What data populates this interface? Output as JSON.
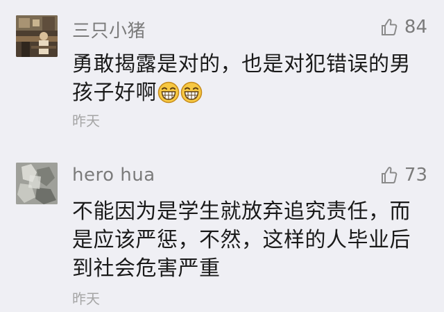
{
  "comments": [
    {
      "username": "三只小猪",
      "likes": "84",
      "body_before_emoji": "勇敢揭露是对的，也是对犯错误的男孩子好啊",
      "emojis": [
        "grinning-face-icon",
        "grinning-face-icon"
      ],
      "time": "昨天"
    },
    {
      "username": "hero hua",
      "likes": "73",
      "body": "不能因为是学生就放弃追究责任，而是应该严惩，不然，这样的人毕业后到社会危害严重",
      "time": "昨天"
    }
  ],
  "icons": {
    "like": "thumbs-up-icon",
    "emoji": "grinning-face-icon"
  },
  "colors": {
    "background": "#efeff4",
    "meta_text": "#7b7b7b",
    "body_text": "#1a1a1a",
    "time_text": "#a5a5a5",
    "emoji_fill": "#f7c842"
  }
}
